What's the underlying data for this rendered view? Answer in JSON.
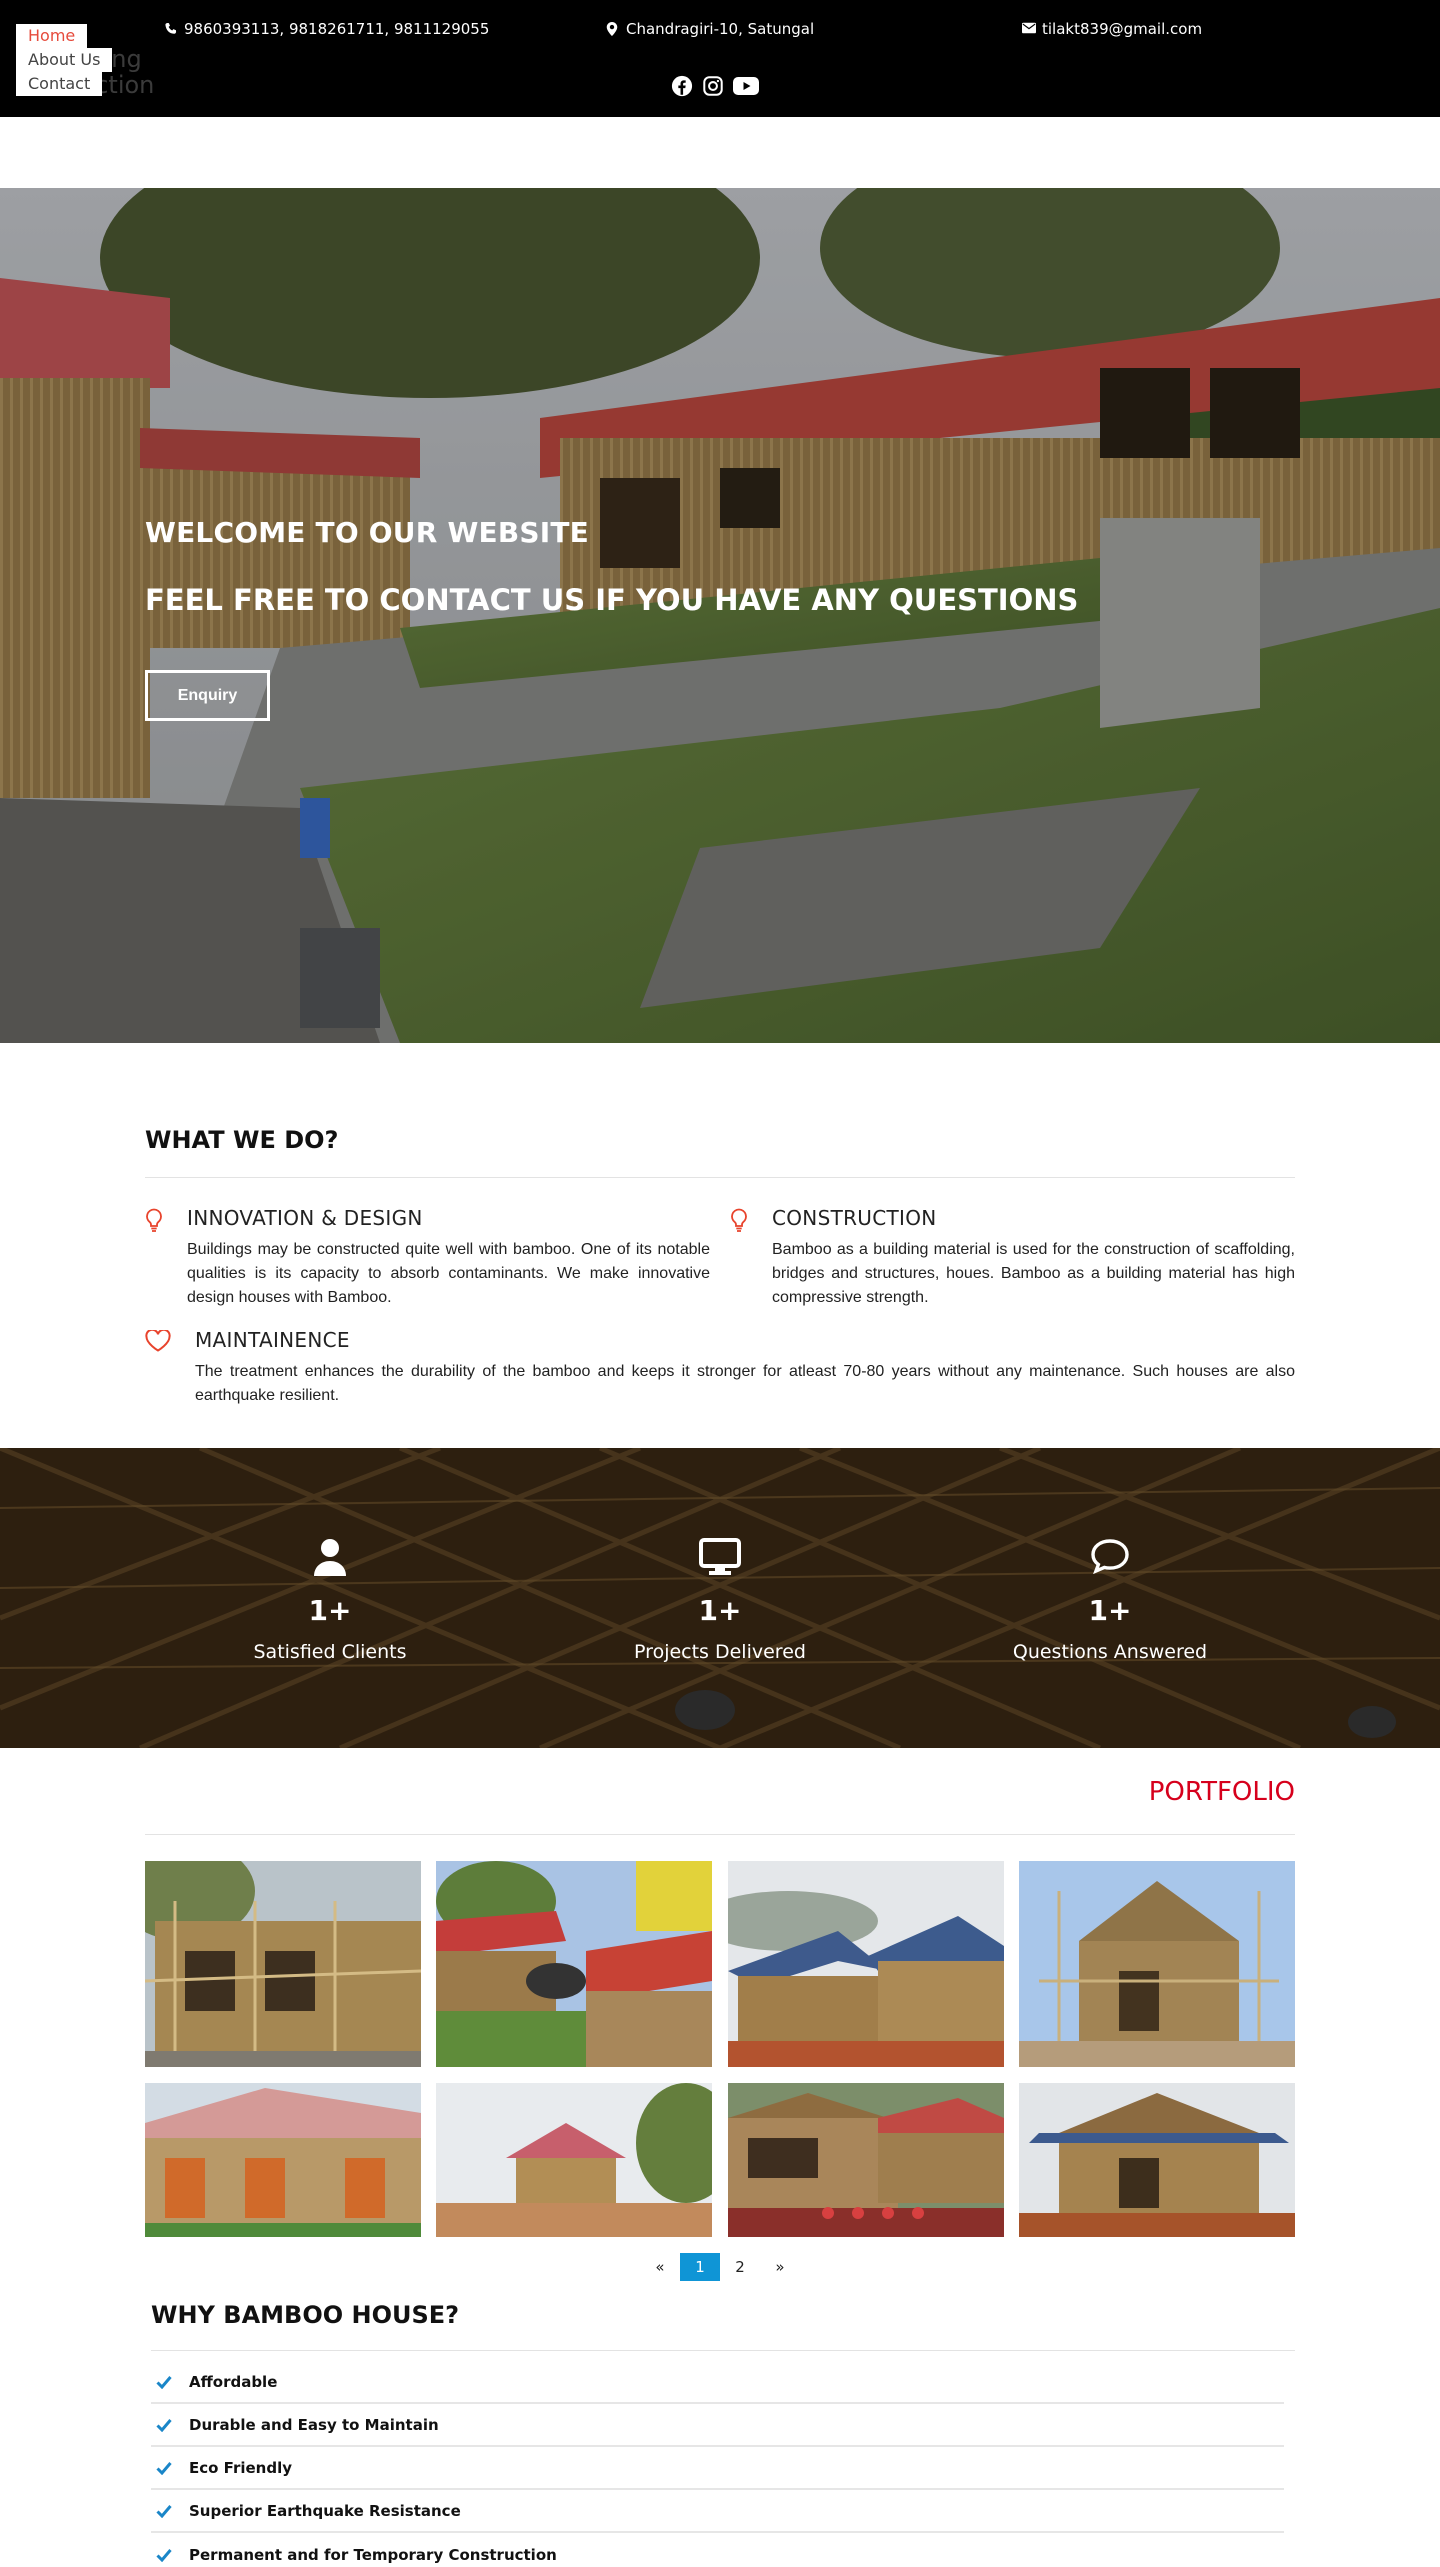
{
  "topbar": {
    "phone": "9860393113, 9818261711, 9811129055",
    "address": "Chandragiri-10, Satungal",
    "email": "tilakt839@gmail.com",
    "socials": [
      "facebook-icon",
      "instagram-icon",
      "youtube-icon"
    ]
  },
  "brand": {
    "line1": "ering",
    "line2": "uction"
  },
  "nav": {
    "items": [
      {
        "label": "Home",
        "active": true
      },
      {
        "label": "About Us"
      },
      {
        "label": "Contact"
      }
    ]
  },
  "hero": {
    "title": "WELCOME TO OUR WEBSITE",
    "subtitle": "FEEL FREE TO CONTACT US IF YOU HAVE ANY QUESTIONS",
    "button": "Enquiry"
  },
  "what_we_do": {
    "title": "WHAT WE DO?",
    "services": [
      {
        "title": "INNOVATION & DESIGN",
        "text": "Buildings may be constructed quite well with bamboo. One of its notable qualities is its capacity to absorb contaminants. We make innovative design houses with Bamboo.",
        "icon": "lightbulb-icon"
      },
      {
        "title": "CONSTRUCTION",
        "text": "Bamboo as a building material is used for the construction of scaffolding, bridges and structures, houes. Bamboo as a building material has high compressive strength.",
        "icon": "lightbulb-icon"
      },
      {
        "title": "MAINTAINENCE",
        "text": "The treatment enhances the durability of the bamboo and keeps it stronger for atleast 70-80 years without any maintenance. Such houses are also earthquake resilient.",
        "icon": "heart-icon"
      }
    ]
  },
  "stats": [
    {
      "icon": "user-icon",
      "number": "1+",
      "label": "Satisfied Clients"
    },
    {
      "icon": "monitor-icon",
      "number": "1+",
      "label": "Projects Delivered"
    },
    {
      "icon": "chat-bubble-icon",
      "number": "1+",
      "label": "Questions Answered"
    }
  ],
  "portfolio": {
    "title": "PORTFOLIO",
    "pagination": {
      "prev": "«",
      "pages": [
        "1",
        "2"
      ],
      "current": "1",
      "next": "»"
    }
  },
  "why": {
    "title": "WHY BAMBOO HOUSE?",
    "items": [
      "Affordable",
      "Durable and Easy to Maintain",
      "Eco Friendly",
      "Superior Earthquake Resistance",
      "Permanent and for Temporary Construction"
    ]
  },
  "colors": {
    "accent_red": "#d6001c",
    "nav_active": "#e64b3c",
    "pager_active": "#0f95d6",
    "check": "#1a86c8",
    "service_icon": "#e8432c"
  }
}
